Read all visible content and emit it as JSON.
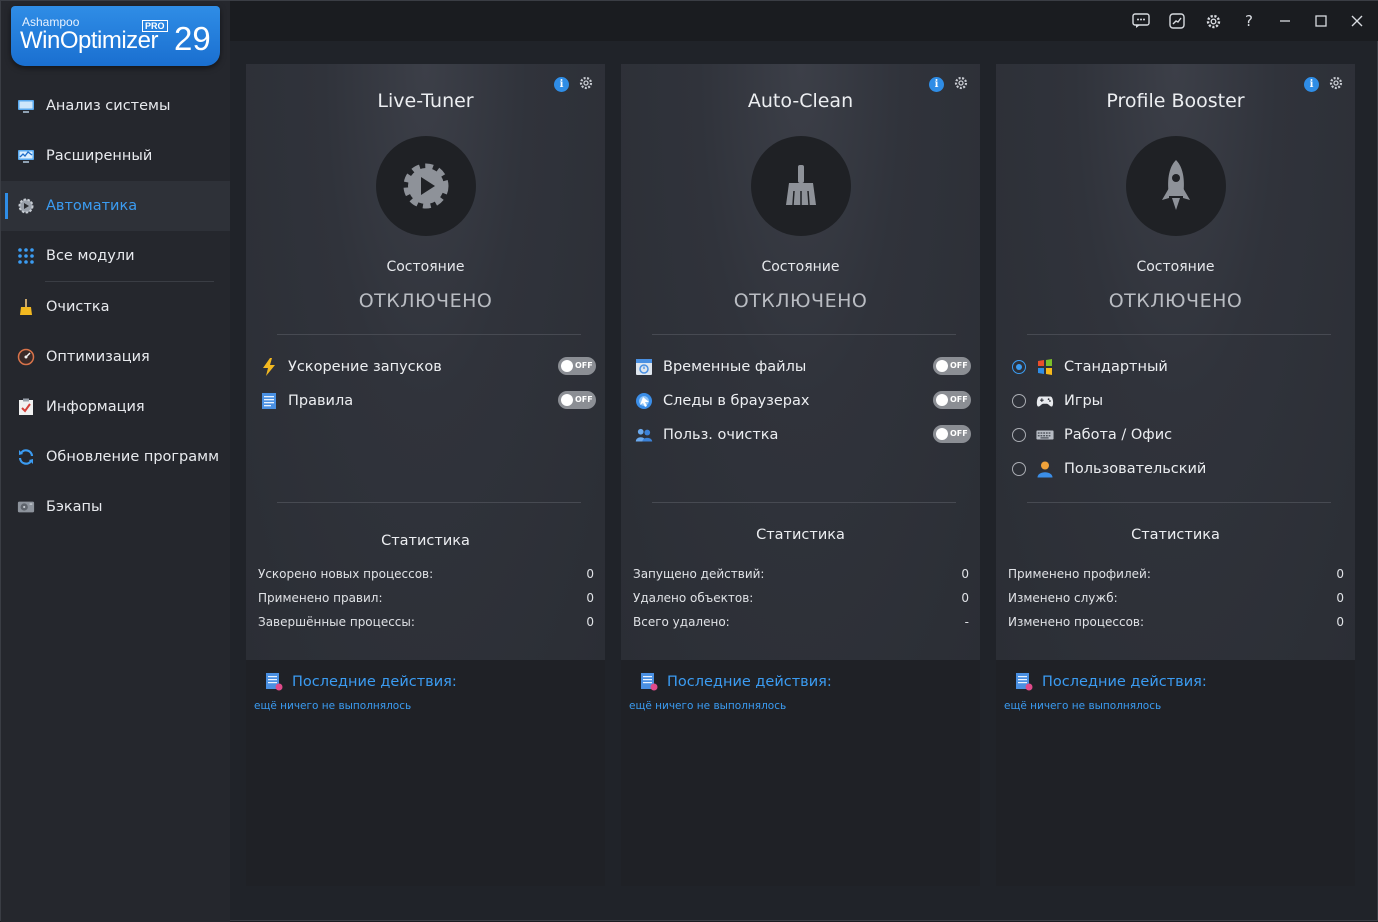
{
  "app": {
    "brand": "Ashampoo",
    "product": "WinOptimizer",
    "edition": "PRO",
    "version": "29",
    "accent": "#2f8de6"
  },
  "sidebar": {
    "items": [
      {
        "label": "Анализ системы",
        "icon": "monitor-icon"
      },
      {
        "label": "Расширенный",
        "icon": "chart-monitor-icon"
      },
      {
        "label": "Автоматика",
        "icon": "auto-gear-icon",
        "active": true
      },
      {
        "label": "Все модули",
        "icon": "grid-dots-icon"
      },
      {
        "label": "Очистка",
        "icon": "broom-icon"
      },
      {
        "label": "Оптимизация",
        "icon": "speedometer-icon"
      },
      {
        "label": "Информация",
        "icon": "checklist-icon"
      },
      {
        "label": "Обновление программ",
        "icon": "refresh-icon"
      },
      {
        "label": "Бэкапы",
        "icon": "disk-icon"
      }
    ]
  },
  "titlebar": {
    "buttons": [
      "feedback-icon",
      "chart-icon",
      "settings-icon",
      "help-icon",
      "minimize-icon",
      "maximize-icon",
      "close-icon"
    ],
    "help_glyph": "?"
  },
  "panels": [
    {
      "title": "Live-Tuner",
      "icon": "play-gear-icon",
      "state_label": "Состояние",
      "state_value": "ОТКЛЮЧЕНО",
      "options": [
        {
          "label": "Ускорение запусков",
          "icon": "lightning-icon",
          "toggle": "OFF"
        },
        {
          "label": "Правила",
          "icon": "rules-list-icon",
          "toggle": "OFF"
        }
      ],
      "stats_title": "Статистика",
      "stats": [
        {
          "label": "Ускорено новых процессов:",
          "value": "0"
        },
        {
          "label": "Применено правил:",
          "value": "0"
        },
        {
          "label": "Завершённые процессы:",
          "value": "0"
        }
      ],
      "last_title": "Последние действия:",
      "last_text": "ещё ничего не выполнялось"
    },
    {
      "title": "Auto-Clean",
      "icon": "brush-icon",
      "state_label": "Состояние",
      "state_value": "ОТКЛЮЧЕНО",
      "options": [
        {
          "label": "Временные файлы",
          "icon": "temp-files-icon",
          "toggle": "OFF"
        },
        {
          "label": "Следы в браузерах",
          "icon": "browser-icon",
          "toggle": "OFF"
        },
        {
          "label": "Польз. очистка",
          "icon": "users-icon",
          "toggle": "OFF"
        }
      ],
      "stats_title": "Статистика",
      "stats": [
        {
          "label": "Запущено действий:",
          "value": "0"
        },
        {
          "label": "Удалено объектов:",
          "value": "0"
        },
        {
          "label": "Всего удалено:",
          "value": "-"
        }
      ],
      "last_title": "Последние действия:",
      "last_text": "ещё ничего не выполнялось"
    },
    {
      "title": "Profile Booster",
      "icon": "rocket-icon",
      "state_label": "Состояние",
      "state_value": "ОТКЛЮЧЕНО",
      "profiles": [
        {
          "label": "Стандартный",
          "icon": "windows-icon",
          "selected": true
        },
        {
          "label": "Игры",
          "icon": "gamepad-icon",
          "selected": false
        },
        {
          "label": "Работа / Офис",
          "icon": "keyboard-icon",
          "selected": false
        },
        {
          "label": "Пользовательский",
          "icon": "user-icon",
          "selected": false
        }
      ],
      "stats_title": "Статистика",
      "stats": [
        {
          "label": "Применено профилей:",
          "value": "0"
        },
        {
          "label": "Изменено служб:",
          "value": "0"
        },
        {
          "label": "Изменено процессов:",
          "value": "0"
        }
      ],
      "last_title": "Последние действия:",
      "last_text": "ещё ничего не выполнялось"
    }
  ]
}
